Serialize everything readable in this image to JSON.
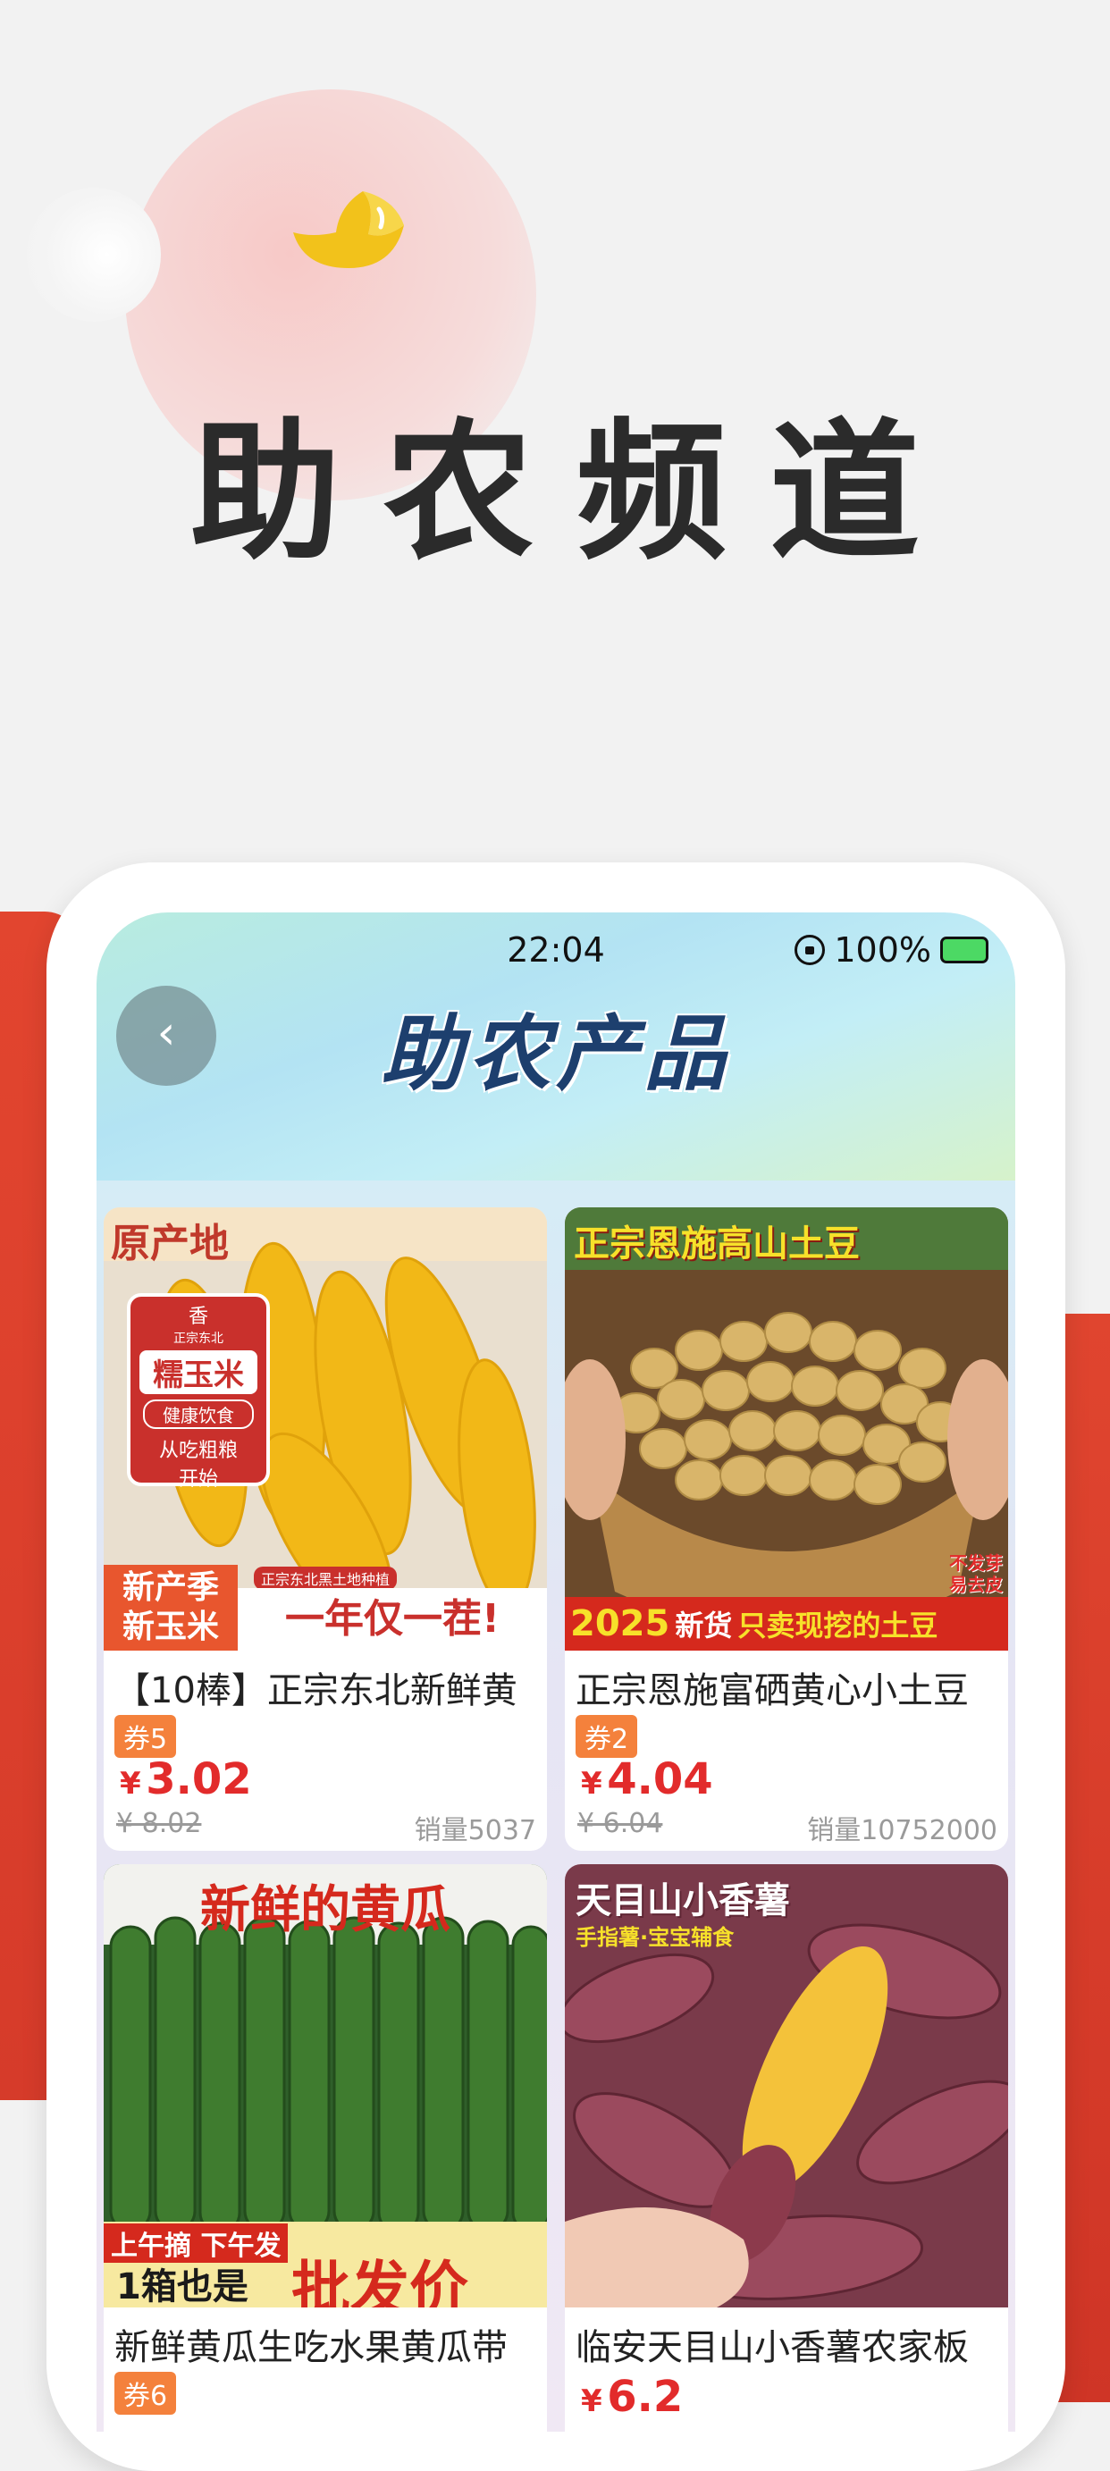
{
  "hero": {
    "title": "助农频道"
  },
  "status_bar": {
    "time": "22:04",
    "battery": "100%"
  },
  "header": {
    "title": "助农产品",
    "back_symbol": "‹"
  },
  "products": [
    {
      "name": "【10棒】正宗东北新鲜黄",
      "coupon": "券5",
      "currency": "¥",
      "price": "3.02",
      "original_price": "¥ 8.02",
      "sales": "销量5037",
      "image_text": {
        "origin": "原产地",
        "badge_top": "香",
        "badge_small": "正宗东北",
        "badge_main": "糯玉米",
        "badge_pill": "健康饮食",
        "badge_line1": "从吃粗粮",
        "badge_line2": "开始",
        "season1": "新产季",
        "season2": "新玉米",
        "banner_small": "正宗东北黑土地种植",
        "banner": "一年仅一茬!"
      }
    },
    {
      "name": "正宗恩施富硒黄心小土豆",
      "coupon": "券2",
      "currency": "¥",
      "price": "4.04",
      "original_price": "¥ 6.04",
      "sales": "销量10752000",
      "image_text": {
        "top": "正宗恩施高山土豆",
        "side1": "不发芽",
        "side2": "易去皮",
        "year": "2025",
        "new": "新货",
        "bottom": "只卖现挖的土豆"
      }
    },
    {
      "name": "新鲜黄瓜生吃水果黄瓜带",
      "coupon": "券6",
      "currency": "¥",
      "price": "",
      "original_price": "",
      "sales": "",
      "image_text": {
        "top": "新鲜的黄瓜",
        "small": "上午摘 下午发",
        "box": "1箱也是",
        "big": "批发价"
      }
    },
    {
      "name": "临安天目山小香薯农家板",
      "coupon": "",
      "currency": "¥",
      "price": "6.2",
      "original_price": "",
      "sales": "",
      "image_text": {
        "top": "天目山小香薯",
        "sub": "手指薯·宝宝辅食"
      }
    }
  ]
}
